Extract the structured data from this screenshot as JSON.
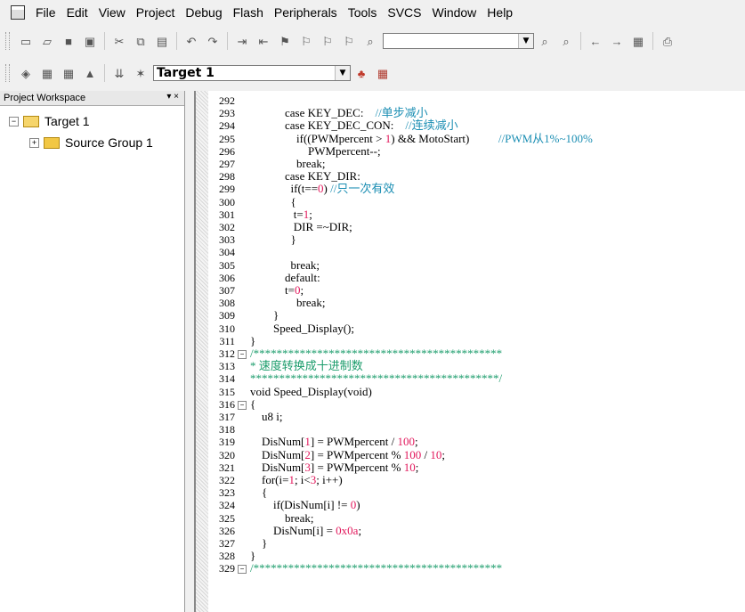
{
  "menu": [
    "File",
    "Edit",
    "View",
    "Project",
    "Debug",
    "Flash",
    "Peripherals",
    "Tools",
    "SVCS",
    "Window",
    "Help"
  ],
  "toolbar": {
    "target_select": "Target 1",
    "find_combo": ""
  },
  "workspace": {
    "title": "Project Workspace",
    "controls": "▾ ×",
    "tree": [
      "Target 1",
      "Source Group 1"
    ]
  },
  "editor": {
    "lines": [
      {
        "n": "292",
        "t": ""
      },
      {
        "n": "293",
        "t": "            case KEY_DEC:    //单步减小"
      },
      {
        "n": "294",
        "t": "            case KEY_DEC_CON:    //连续减小"
      },
      {
        "n": "295",
        "t": "                if((PWMpercent > 1) && MotoStart)          //PWM从1%~100%"
      },
      {
        "n": "296",
        "t": "                    PWMpercent--;"
      },
      {
        "n": "297",
        "t": "                break;"
      },
      {
        "n": "298",
        "t": "            case KEY_DIR:"
      },
      {
        "n": "299",
        "t": "              if(t==0) //只一次有效"
      },
      {
        "n": "300",
        "t": "              {"
      },
      {
        "n": "301",
        "t": "               t=1;"
      },
      {
        "n": "302",
        "t": "               DIR =~DIR;"
      },
      {
        "n": "303",
        "t": "              }"
      },
      {
        "n": "304",
        "t": ""
      },
      {
        "n": "305",
        "t": "              break;"
      },
      {
        "n": "306",
        "t": "            default:"
      },
      {
        "n": "307",
        "t": "            t=0;"
      },
      {
        "n": "308",
        "t": "                break;"
      },
      {
        "n": "309",
        "t": "        }"
      },
      {
        "n": "310",
        "t": "        Speed_Display();"
      },
      {
        "n": "311",
        "t": "}"
      },
      {
        "n": "312",
        "t": "/*******************************************"
      },
      {
        "n": "313",
        "t": "* 速度转换成十进制数"
      },
      {
        "n": "314",
        "t": "*******************************************/"
      },
      {
        "n": "315",
        "t": "void Speed_Display(void)"
      },
      {
        "n": "316",
        "t": "{"
      },
      {
        "n": "317",
        "t": "    u8 i;"
      },
      {
        "n": "318",
        "t": ""
      },
      {
        "n": "319",
        "t": "    DisNum[1] = PWMpercent / 100;"
      },
      {
        "n": "320",
        "t": "    DisNum[2] = PWMpercent % 100 / 10;"
      },
      {
        "n": "321",
        "t": "    DisNum[3] = PWMpercent % 10;"
      },
      {
        "n": "322",
        "t": "    for(i=1; i<3; i++)"
      },
      {
        "n": "323",
        "t": "    {"
      },
      {
        "n": "324",
        "t": "        if(DisNum[i] != 0)"
      },
      {
        "n": "325",
        "t": "            break;"
      },
      {
        "n": "326",
        "t": "        DisNum[i] = 0x0a;"
      },
      {
        "n": "327",
        "t": "    }"
      },
      {
        "n": "328",
        "t": "}"
      },
      {
        "n": "329",
        "t": "/*******************************************"
      }
    ]
  }
}
